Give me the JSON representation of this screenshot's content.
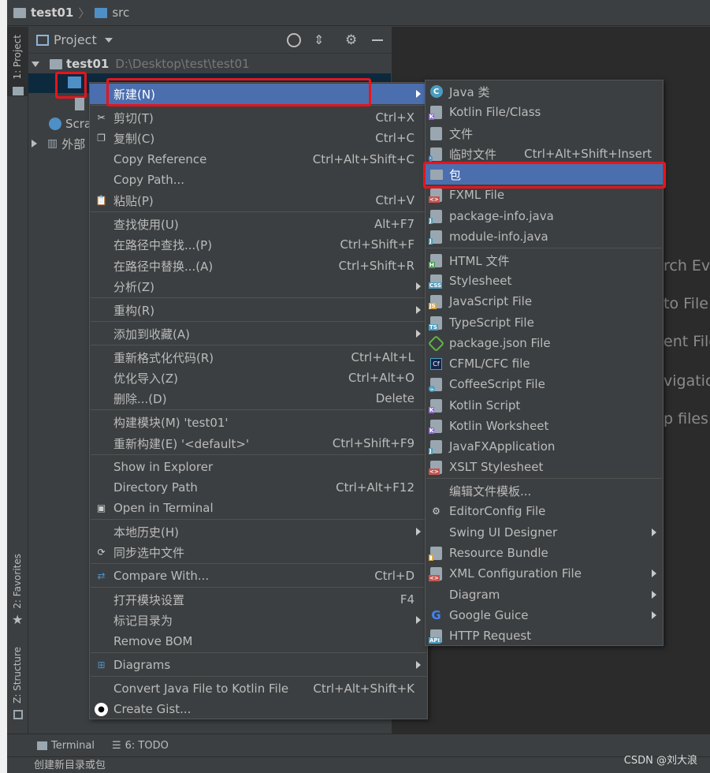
{
  "navbar": {
    "project": "test01",
    "folder": "src"
  },
  "left_strip": {
    "project_tab": "1: Project",
    "favorites_tab": "2: Favorites",
    "structure_tab": "Z: Structure"
  },
  "project_panel": {
    "title": "Project",
    "root_name": "test01",
    "root_path": "D:\\Desktop\\test\\test01",
    "scratches": "Scra",
    "external": "外部"
  },
  "editor_hints": [
    "rch Ev",
    "to File",
    "ent File",
    "vigatio",
    "p files"
  ],
  "context_menu": {
    "items": [
      {
        "label": "新建(N)",
        "shortcut": "",
        "submenu": true
      },
      {
        "label": "剪切(T)",
        "shortcut": "Ctrl+X"
      },
      {
        "label": "复制(C)",
        "shortcut": "Ctrl+C"
      },
      {
        "label": "Copy Reference",
        "shortcut": "Ctrl+Alt+Shift+C"
      },
      {
        "label": "Copy Path...",
        "shortcut": ""
      },
      {
        "label": "粘贴(P)",
        "shortcut": "Ctrl+V"
      },
      {
        "label": "查找使用(U)",
        "shortcut": "Alt+F7"
      },
      {
        "label": "在路径中查找...(P)",
        "shortcut": "Ctrl+Shift+F"
      },
      {
        "label": "在路径中替换...(A)",
        "shortcut": "Ctrl+Shift+R"
      },
      {
        "label": "分析(Z)",
        "shortcut": "",
        "submenu": true
      },
      {
        "label": "重构(R)",
        "shortcut": "",
        "submenu": true
      },
      {
        "label": "添加到收藏(A)",
        "shortcut": "",
        "submenu": true
      },
      {
        "label": "重新格式化代码(R)",
        "shortcut": "Ctrl+Alt+L"
      },
      {
        "label": "优化导入(Z)",
        "shortcut": "Ctrl+Alt+O"
      },
      {
        "label": "删除...(D)",
        "shortcut": "Delete"
      },
      {
        "label": "构建模块(M) 'test01'",
        "shortcut": ""
      },
      {
        "label": "重新构建(E) '<default>'",
        "shortcut": "Ctrl+Shift+F9"
      },
      {
        "label": "Show in Explorer",
        "shortcut": ""
      },
      {
        "label": "Directory Path",
        "shortcut": "Ctrl+Alt+F12"
      },
      {
        "label": "Open in Terminal",
        "shortcut": ""
      },
      {
        "label": "本地历史(H)",
        "shortcut": "",
        "submenu": true
      },
      {
        "label": "同步选中文件",
        "shortcut": ""
      },
      {
        "label": "Compare With...",
        "shortcut": "Ctrl+D"
      },
      {
        "label": "打开模块设置",
        "shortcut": "F4"
      },
      {
        "label": "标记目录为",
        "shortcut": "",
        "submenu": true
      },
      {
        "label": "Remove BOM",
        "shortcut": ""
      },
      {
        "label": "Diagrams",
        "shortcut": "",
        "submenu": true
      },
      {
        "label": "Convert Java File to Kotlin File",
        "shortcut": "Ctrl+Alt+Shift+K"
      },
      {
        "label": "Create Gist...",
        "shortcut": ""
      }
    ]
  },
  "new_submenu": {
    "items": [
      {
        "label": "Java 类",
        "shortcut": ""
      },
      {
        "label": "Kotlin File/Class",
        "shortcut": ""
      },
      {
        "label": "文件",
        "shortcut": ""
      },
      {
        "label": "临时文件",
        "shortcut": "Ctrl+Alt+Shift+Insert"
      },
      {
        "label": "包",
        "shortcut": ""
      },
      {
        "label": "FXML File",
        "shortcut": ""
      },
      {
        "label": "package-info.java",
        "shortcut": ""
      },
      {
        "label": "module-info.java",
        "shortcut": ""
      },
      {
        "label": "HTML 文件",
        "shortcut": ""
      },
      {
        "label": "Stylesheet",
        "shortcut": ""
      },
      {
        "label": "JavaScript File",
        "shortcut": ""
      },
      {
        "label": "TypeScript File",
        "shortcut": ""
      },
      {
        "label": "package.json File",
        "shortcut": ""
      },
      {
        "label": "CFML/CFC file",
        "shortcut": ""
      },
      {
        "label": "CoffeeScript File",
        "shortcut": ""
      },
      {
        "label": "Kotlin Script",
        "shortcut": ""
      },
      {
        "label": "Kotlin Worksheet",
        "shortcut": ""
      },
      {
        "label": "JavaFXApplication",
        "shortcut": ""
      },
      {
        "label": "XSLT Stylesheet",
        "shortcut": ""
      },
      {
        "label": "编辑文件模板...",
        "shortcut": ""
      },
      {
        "label": "EditorConfig File",
        "shortcut": ""
      },
      {
        "label": "Swing UI Designer",
        "shortcut": "",
        "submenu": true
      },
      {
        "label": "Resource Bundle",
        "shortcut": ""
      },
      {
        "label": "XML Configuration File",
        "shortcut": "",
        "submenu": true
      },
      {
        "label": "Diagram",
        "shortcut": "",
        "submenu": true
      },
      {
        "label": "Google Guice",
        "shortcut": "",
        "submenu": true
      },
      {
        "label": "HTTP Request",
        "shortcut": ""
      }
    ]
  },
  "bottom_bar": {
    "terminal": "Terminal",
    "todo": "6: TODO"
  },
  "status": {
    "text": "创建新目录或包"
  },
  "watermark": "CSDN @刘大浪",
  "colors": {
    "selection": "#4b6eaf",
    "highlight_box": "#e8141b",
    "editor_bg": "#2b2b2b",
    "panel_bg": "#3c3f41"
  }
}
